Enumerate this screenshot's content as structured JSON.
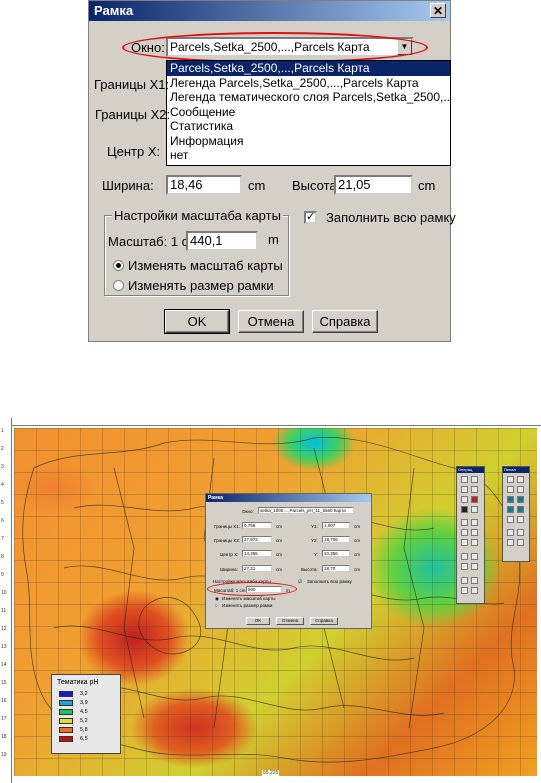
{
  "dialog": {
    "title": "Рамка",
    "window_label": "Окно:",
    "window_value": "Parcels,Setka_2500,...,Parcels Карта",
    "dropdown_options": [
      "Parcels,Setka_2500,...,Parcels Карта",
      "Легенда Parcels,Setka_2500,...,Parcels Карта",
      "Легенда тематического слоя Parcels,Setka_2500,...,Par",
      "Сообщение",
      "Статистика",
      "Информация",
      "нет"
    ],
    "bounds_x1_label": "Границы X1:",
    "bounds_x2_label": "Границы X2:",
    "center_x_label": "Центр X:",
    "width_label": "Ширина:",
    "width_value": "18,46",
    "width_unit": "cm",
    "height_label": "Высота:",
    "height_value": "21,05",
    "height_unit": "cm",
    "scale_group_title": "Настройки масштаба карты",
    "scale_label": "Масштаб: 1 cm",
    "scale_value": "440,1",
    "scale_unit": "m",
    "radio_change_scale": "Изменять масштаб карты",
    "radio_change_size": "Изменять размер рамки",
    "fill_frame_label": "Заполнить всю рамку",
    "ok_label": "OK",
    "cancel_label": "Отмена",
    "help_label": "Справка"
  },
  "mini_dialog": {
    "title": "Рамка",
    "window_label": "Окно:",
    "window_value": "setka_1000,...,Parcels_pH_11_5560 Карта",
    "x1_label": "Границы X1:",
    "x1_value": "0,758",
    "x1_unit": "cm",
    "y1_label": "Y1:",
    "y1_value": "1,007",
    "y1_unit": "cm",
    "x2_label": "Границы X2:",
    "x2_value": "27,972",
    "x2_unit": "cm",
    "y2_label": "Y2:",
    "y2_value": "19,706",
    "y2_unit": "cm",
    "cx_label": "Центр X:",
    "cx_value": "14,365",
    "cx_unit": "cm",
    "cy_label": "Y:",
    "cy_value": "10,356",
    "cy_unit": "cm",
    "w_label": "Ширина:",
    "w_value": "27,21",
    "w_unit": "cm",
    "h_label": "Высота:",
    "h_value": "18,70",
    "h_unit": "cm",
    "group_title": "Настройки масштаба карты",
    "fill_label": "Заполнить всю рамку",
    "scale_label": "Масштаб: 1 cm",
    "scale_value": "500",
    "scale_unit": "m",
    "radio1": "Изменять масштаб карты",
    "radio2": "Изменять размер рамки",
    "ok": "OK",
    "cancel": "Отмена",
    "help": "Справка"
  },
  "legend": {
    "title": "Тематика  pH",
    "items": [
      {
        "color": "#1020c0",
        "label": "3,2"
      },
      {
        "color": "#20a0e0",
        "label": "3,9"
      },
      {
        "color": "#20c060",
        "label": "4,5"
      },
      {
        "color": "#e0e020",
        "label": "5,2"
      },
      {
        "color": "#f07020",
        "label": "5,8"
      },
      {
        "color": "#c01010",
        "label": "6,5"
      }
    ]
  },
  "toolbars": {
    "ops_title": "Операц",
    "draw_title": "Пенал"
  },
  "ruler_numbers": [
    "1",
    "2",
    "3",
    "4",
    "5",
    "6",
    "7",
    "8",
    "9",
    "10",
    "11",
    "12",
    "13",
    "14",
    "15",
    "16",
    "17",
    "18",
    "19"
  ],
  "scale_bar_label": "55,225"
}
